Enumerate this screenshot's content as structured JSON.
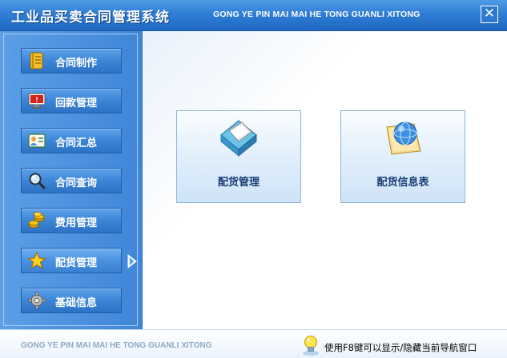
{
  "window": {
    "title_cn": "工业品买卖合同管理系统",
    "title_en": "GONG YE PIN MAI MAI HE TONG GUANLI XITONG",
    "close_glyph": "✕"
  },
  "sidebar": {
    "items": [
      {
        "label": "合同制作",
        "icon": "ledger-icon"
      },
      {
        "label": "回款管理",
        "icon": "monitor-icon"
      },
      {
        "label": "合同汇总",
        "icon": "contact-card-icon"
      },
      {
        "label": "合同查询",
        "icon": "magnifier-icon"
      },
      {
        "label": "费用管理",
        "icon": "coins-icon"
      },
      {
        "label": "配货管理",
        "icon": "star-icon",
        "active": true
      },
      {
        "label": "基础信息",
        "icon": "gear-icon"
      }
    ]
  },
  "main": {
    "cards": [
      {
        "label": "配货管理",
        "icon": "cube-book-icon"
      },
      {
        "label": "配货信息表",
        "icon": "globe-document-icon"
      }
    ]
  },
  "footer": {
    "brand_en": "GONG YE PIN MAI MAI HE TONG GUANLI XITONG",
    "tip": "使用F8键可以显示/隐藏当前导航窗口",
    "tip_icon": "lightbulb-icon"
  },
  "colors": {
    "titlebar": "#2f7ed6",
    "sidebar": "#4a8fdd",
    "card_text": "#1b3f73"
  }
}
